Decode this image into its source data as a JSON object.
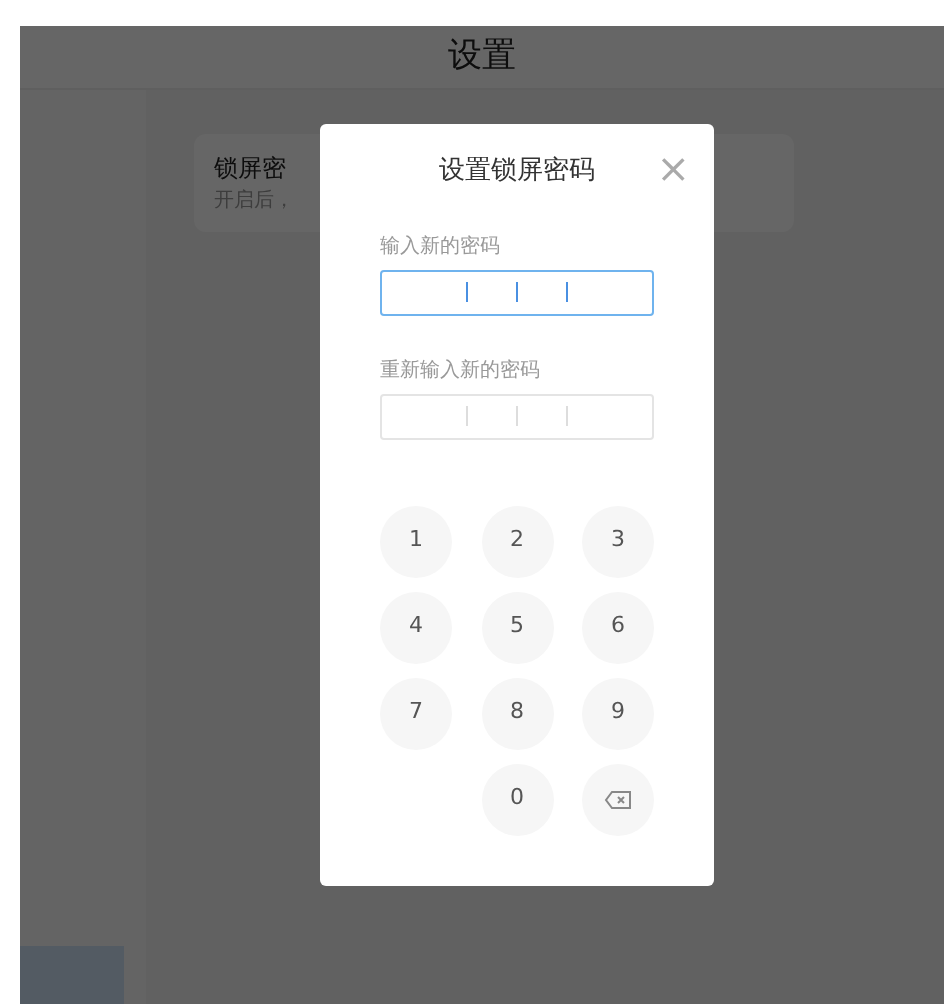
{
  "header": {
    "title": "设置"
  },
  "sidebar": {
    "items": [
      {
        "selected": true
      }
    ]
  },
  "setting_card": {
    "title": "锁屏密",
    "subtitle": "开启后，"
  },
  "dialog": {
    "title": "设置锁屏密码",
    "close": "×",
    "fields": [
      {
        "label": "输入新的密码",
        "focused": true
      },
      {
        "label": "重新输入新的密码",
        "focused": false
      }
    ],
    "keypad": [
      {
        "kind": "digit",
        "label": "1"
      },
      {
        "kind": "digit",
        "label": "2"
      },
      {
        "kind": "digit",
        "label": "3"
      },
      {
        "kind": "digit",
        "label": "4"
      },
      {
        "kind": "digit",
        "label": "5"
      },
      {
        "kind": "digit",
        "label": "6"
      },
      {
        "kind": "digit",
        "label": "7"
      },
      {
        "kind": "digit",
        "label": "8"
      },
      {
        "kind": "digit",
        "label": "9"
      },
      {
        "kind": "empty"
      },
      {
        "kind": "digit",
        "label": "0"
      },
      {
        "kind": "backspace"
      }
    ]
  }
}
